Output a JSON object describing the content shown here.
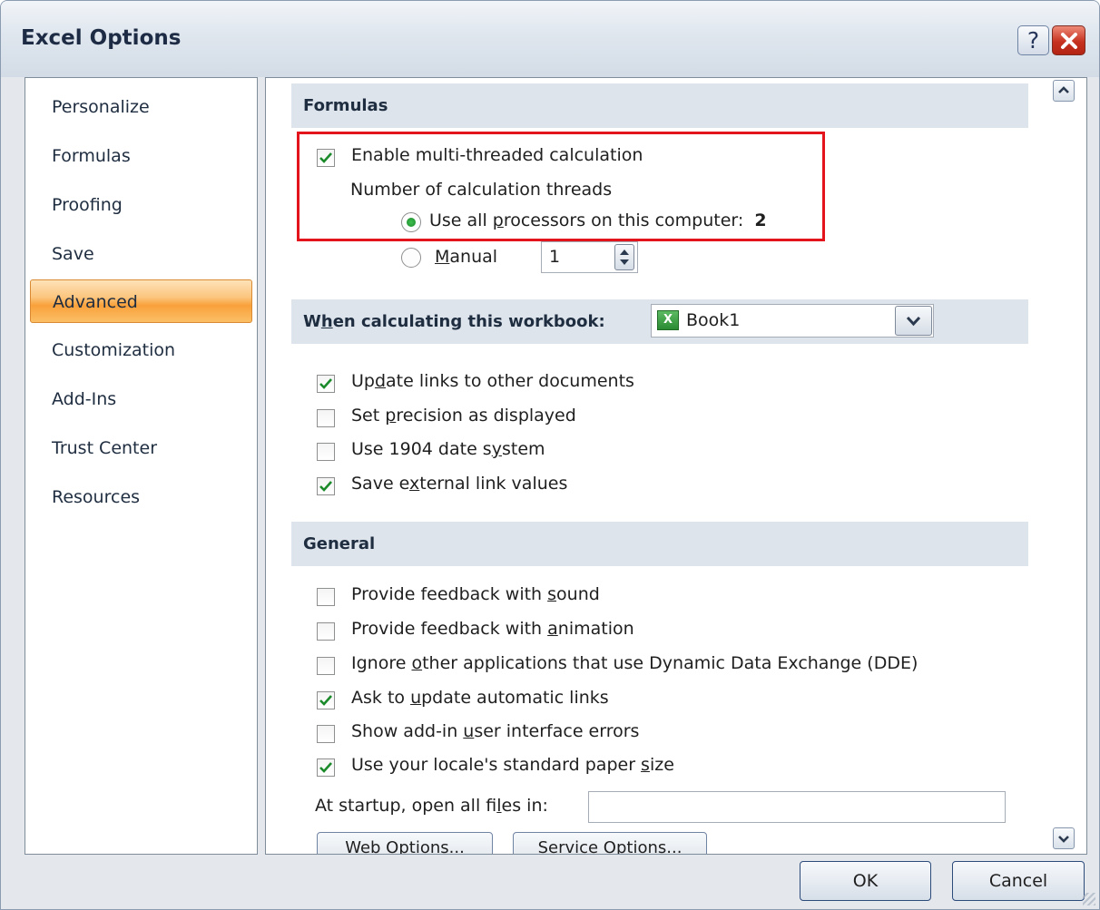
{
  "window": {
    "title": "Excel Options",
    "help_glyph": "?"
  },
  "nav": {
    "items": [
      {
        "label": "Personalize"
      },
      {
        "label": "Formulas"
      },
      {
        "label": "Proofing"
      },
      {
        "label": "Save"
      },
      {
        "label": "Advanced",
        "selected": true
      },
      {
        "label": "Customization"
      },
      {
        "label": "Add-Ins"
      },
      {
        "label": "Trust Center"
      },
      {
        "label": "Resources"
      }
    ]
  },
  "formulas": {
    "header": "Formulas",
    "multithread": {
      "label": "Enable multi-threaded calculation",
      "checked": true
    },
    "threads_label": "Number of calculation threads",
    "all_processors": {
      "pre": "Use all ",
      "ul": "p",
      "post": "rocessors on this computer:",
      "count": "2",
      "selected": true
    },
    "manual": {
      "ul": "M",
      "post": "anual",
      "value": "1",
      "selected": false
    }
  },
  "workbook": {
    "header_pre": "W",
    "header_ul": "h",
    "header_post": "en calculating this workbook:",
    "selected": "Book1",
    "options": [
      {
        "pre": "Up",
        "ul": "d",
        "post": "ate links to other documents",
        "checked": true
      },
      {
        "pre": "Set ",
        "ul": "p",
        "post": "recision as displayed",
        "checked": false
      },
      {
        "pre": "Use 1904 date s",
        "ul": "y",
        "post": "stem",
        "checked": false
      },
      {
        "pre": "Save e",
        "ul": "x",
        "post": "ternal link values",
        "checked": true
      }
    ]
  },
  "general": {
    "header": "General",
    "options": [
      {
        "pre": "Provide feedback with ",
        "ul": "s",
        "post": "ound",
        "checked": false
      },
      {
        "pre": "Provide feedback with ",
        "ul": "a",
        "post": "nimation",
        "checked": false
      },
      {
        "pre": "Ignore ",
        "ul": "o",
        "post": "ther applications that use Dynamic Data Exchange (DDE)",
        "checked": false
      },
      {
        "pre": "Ask to ",
        "ul": "u",
        "post": "pdate automatic links",
        "checked": true
      },
      {
        "pre": "Show add-in ",
        "ul": "u",
        "post": "ser interface errors",
        "checked": false
      },
      {
        "pre": "Use your locale's standard paper ",
        "ul": "s",
        "post": "ize",
        "checked": true
      }
    ],
    "startup": {
      "pre": "At startup, open all fi",
      "ul": "l",
      "post": "es in:",
      "value": ""
    },
    "web_options": "Web Options...",
    "service_options": "Service Options..."
  },
  "buttons": {
    "ok": "OK",
    "cancel": "Cancel"
  },
  "colors": {
    "accent_selected": "#f9a13b",
    "highlight_box": "#e3141b",
    "check": "#1a8a2a"
  }
}
